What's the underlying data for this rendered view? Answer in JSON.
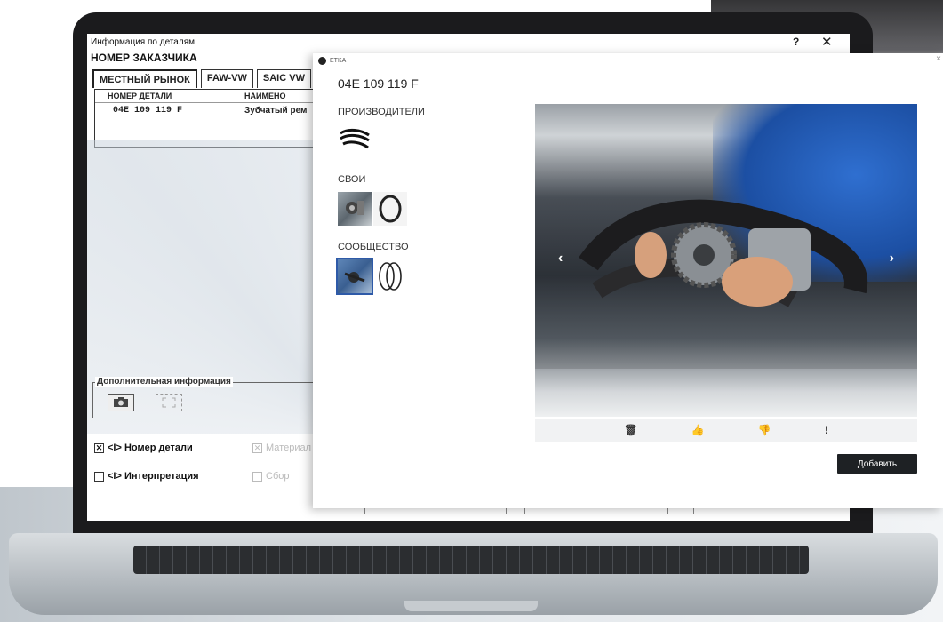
{
  "app": {
    "title": "Информация по деталям",
    "help_label": "?",
    "close_label": "✕",
    "customer_number_label": "НОМЕР ЗАКАЗЧИКА"
  },
  "tabs": [
    {
      "label": "МЕСТНЫЙ РЫНОК",
      "active": true
    },
    {
      "label": "FAW-VW",
      "active": false
    },
    {
      "label": "SAIC VW",
      "active": false
    }
  ],
  "parts_table": {
    "columns": [
      "НОМЕР ДЕТАЛИ",
      "НАИМЕНО"
    ],
    "rows": [
      {
        "number": "04E 109 119 F",
        "name": "Зубчатый рем"
      }
    ]
  },
  "additional_info": {
    "title": "Дополнительная информация"
  },
  "options": [
    {
      "label": "<I> Номер детали",
      "checked": true,
      "enabled": true
    },
    {
      "label": "Материал",
      "checked": true,
      "enabled": false
    },
    {
      "label": "<I> Интерпретация",
      "checked": false,
      "enabled": true
    },
    {
      "label": "Сбор",
      "checked": false,
      "enabled": false
    }
  ],
  "etka": {
    "window_title": "ETKA",
    "close_label": "×",
    "part_number": "04E 109 119 F",
    "sections": {
      "manufacturers": "ПРОИЗВОДИТЕЛИ",
      "own": "СВОИ",
      "community": "СООБЩЕСТВО"
    },
    "photo": {
      "prev_label": "‹",
      "next_label": "›"
    },
    "actions": {
      "delete_icon": "🗑",
      "like_icon": "👍",
      "dislike_icon": "👎",
      "report_label": "!"
    },
    "add_button": "Добавить"
  }
}
